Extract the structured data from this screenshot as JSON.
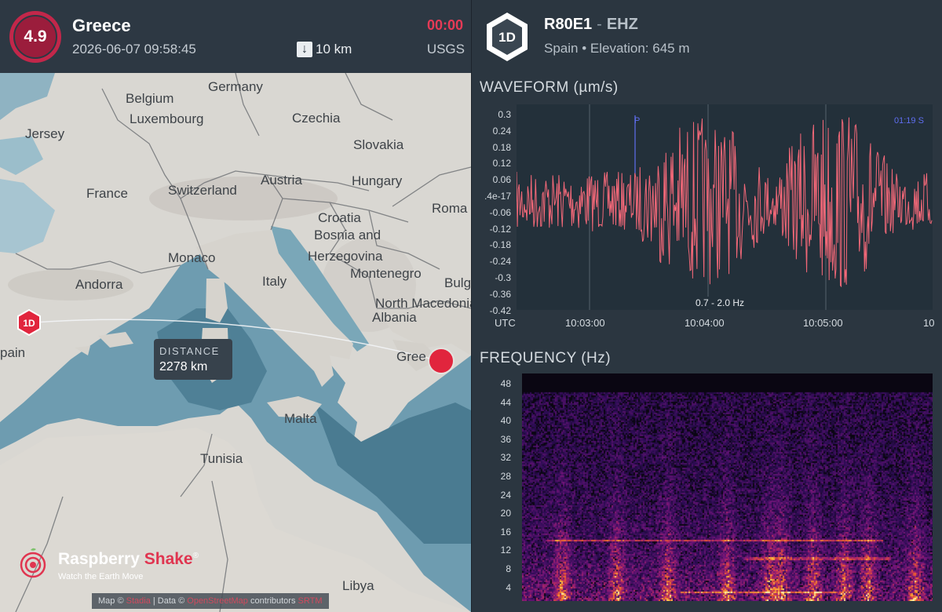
{
  "event": {
    "magnitude": "4.9",
    "region": "Greece",
    "datetime": "2026-06-07 09:58:45",
    "depth": "10 km",
    "depth_icon": "arrow-down-icon",
    "elapsed": "00:00",
    "agency": "USGS"
  },
  "map": {
    "labels": {
      "germany": "Germany",
      "belgium": "Belgium",
      "luxembourg": "Luxembourg",
      "czechia": "Czechia",
      "jersey": "Jersey",
      "slovakia": "Slovakia",
      "france": "France",
      "switzerland": "Switzerland",
      "austria": "Austria",
      "hungary": "Hungary",
      "romania": "Roma",
      "croatia": "Croatia",
      "bosnia": "Bosnia and",
      "herzegovina": "Herzegovina",
      "montenegro": "Montenegro",
      "monaco": "Monaco",
      "andorra": "Andorra",
      "italy": "Italy",
      "bulgaria": "Bulg",
      "north_macedonia": "North Macedonia",
      "albania": "Albania",
      "spain": "pain",
      "greece": "Gree",
      "malta": "Malta",
      "tunisia": "Tunisia",
      "libya": "Libya"
    },
    "station_badge": "1D",
    "distance_label": "DISTANCE",
    "distance_value": "2278 km"
  },
  "brand": {
    "name_part1": "Raspberry",
    "name_part2": "Shake",
    "reg": "®",
    "tagline": "Watch the Earth Move",
    "attribution_prefix": "Map ©",
    "attribution_link1": "Stadia",
    "attribution_mid": "| Data ©",
    "attribution_link2": "OpenStreetMap",
    "attribution_suffix": "contributors",
    "attribution_link3": "SRTM"
  },
  "station": {
    "badge": "1D",
    "code": "R80E1",
    "separator": "-",
    "channel": "EHZ",
    "location": "Spain • Elevation: 645 m"
  },
  "waveform": {
    "title": "WAVEFORM (µm/s)",
    "y_ticks": [
      "0.3",
      "0.24",
      "0.18",
      "0.12",
      "0.06",
      ".4e-17",
      "-0.06",
      "-0.12",
      "-0.18",
      "-0.24",
      "-0.3",
      "-0.36",
      "-0.42"
    ],
    "x_ticks": [
      "UTC",
      "10:03:00",
      "10:04:00",
      "10:05:00",
      "10"
    ],
    "filter": "0.7 - 2.0 Hz",
    "p_label": "P",
    "s_label": "01:19  S",
    "trace_color": "#f26878"
  },
  "frequency": {
    "title": "FREQUENCY (Hz)",
    "y_ticks": [
      "48",
      "44",
      "40",
      "36",
      "32",
      "28",
      "24",
      "20",
      "16",
      "12",
      "8",
      "4"
    ]
  }
}
